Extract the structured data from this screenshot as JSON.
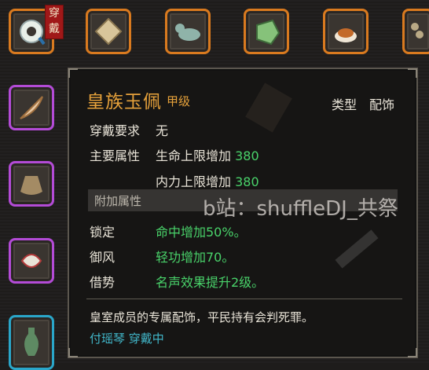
{
  "equipped_badge": "穿戴",
  "item": {
    "name": "皇族玉佩",
    "grade": "甲级",
    "type_label": "类型",
    "type_value": "配饰",
    "requirement_label": "穿戴要求",
    "requirement_value": "无",
    "main_attr_label": "主要属性",
    "main_attrs": [
      {
        "text": "生命上限增加",
        "value": "380"
      },
      {
        "text": "内力上限增加",
        "value": "380"
      }
    ],
    "extra_attr_label": "附加属性",
    "extra_attrs": [
      {
        "label": "锁定",
        "value": "命中增加50%。"
      },
      {
        "label": "御风",
        "value": "轻功增加70。"
      },
      {
        "label": "借势",
        "value": "名声效果提升2级。"
      }
    ],
    "description": "皇室成员的专属配饰，平民持有会判死罪。",
    "wearer": "付瑶琴 穿戴中"
  },
  "watermark": "b站：shuffleDJ_共祭",
  "icons": {
    "top_row": [
      "jade-pendant-icon",
      "map-scroll-icon",
      "jade-beast-icon",
      "jade-stone-icon",
      "cake-icon",
      "beads-icon"
    ],
    "left_col": [
      "feather-icon",
      "pouch-icon",
      "dragon-pendant-icon",
      "vase-icon"
    ]
  }
}
